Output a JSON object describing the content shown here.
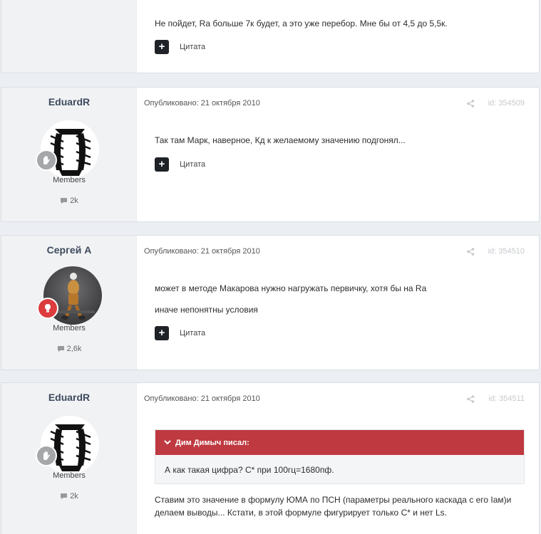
{
  "post_top": {
    "text": "Не пойдет, Ra больше 7к будет, а это уже перебор. Мне бы от 4,5 до 5,5к.",
    "quote_label": "Цитата",
    "quote_icon": "+"
  },
  "posts": [
    {
      "author": "EduardR",
      "group": "Members",
      "post_count": "2k",
      "published": "Опубликовано: 21 октября 2010",
      "id": "id: 354509",
      "lines": [
        "Так там Марк, наверное, Кд к желаемому значению подгонял..."
      ],
      "quote_label": "Цитата",
      "quote_icon": "+"
    },
    {
      "author": "Сергей А",
      "group": "Members",
      "post_count": "2,6k",
      "published": "Опубликовано: 21 октября 2010",
      "id": "id: 354510",
      "lines": [
        "может в методе Макарова нужно нагружать первичку, хотя бы на Ra",
        "иначе непонятны условия"
      ],
      "quote_label": "Цитата",
      "quote_icon": "+"
    },
    {
      "author": "EduardR",
      "group": "Members",
      "post_count": "2k",
      "published": "Опубликовано: 21 октября 2010",
      "id": "id: 354511",
      "quote_header": "Дим Димыч писал:",
      "quote_text": "А как такая цифра? С* при 100гц=1680пф.",
      "lines": [
        "Ставим это значение в формулу ЮМА по ПСН (параметры реального каскада с его Iам)и",
        "делаем выводы... Кстати, в этой формуле фигурирует только С* и нет Ls."
      ]
    }
  ],
  "colors": {
    "accent": "#bf3940",
    "rank_red": "#dc3c3c",
    "rank_gray": "#a5a7aa"
  }
}
